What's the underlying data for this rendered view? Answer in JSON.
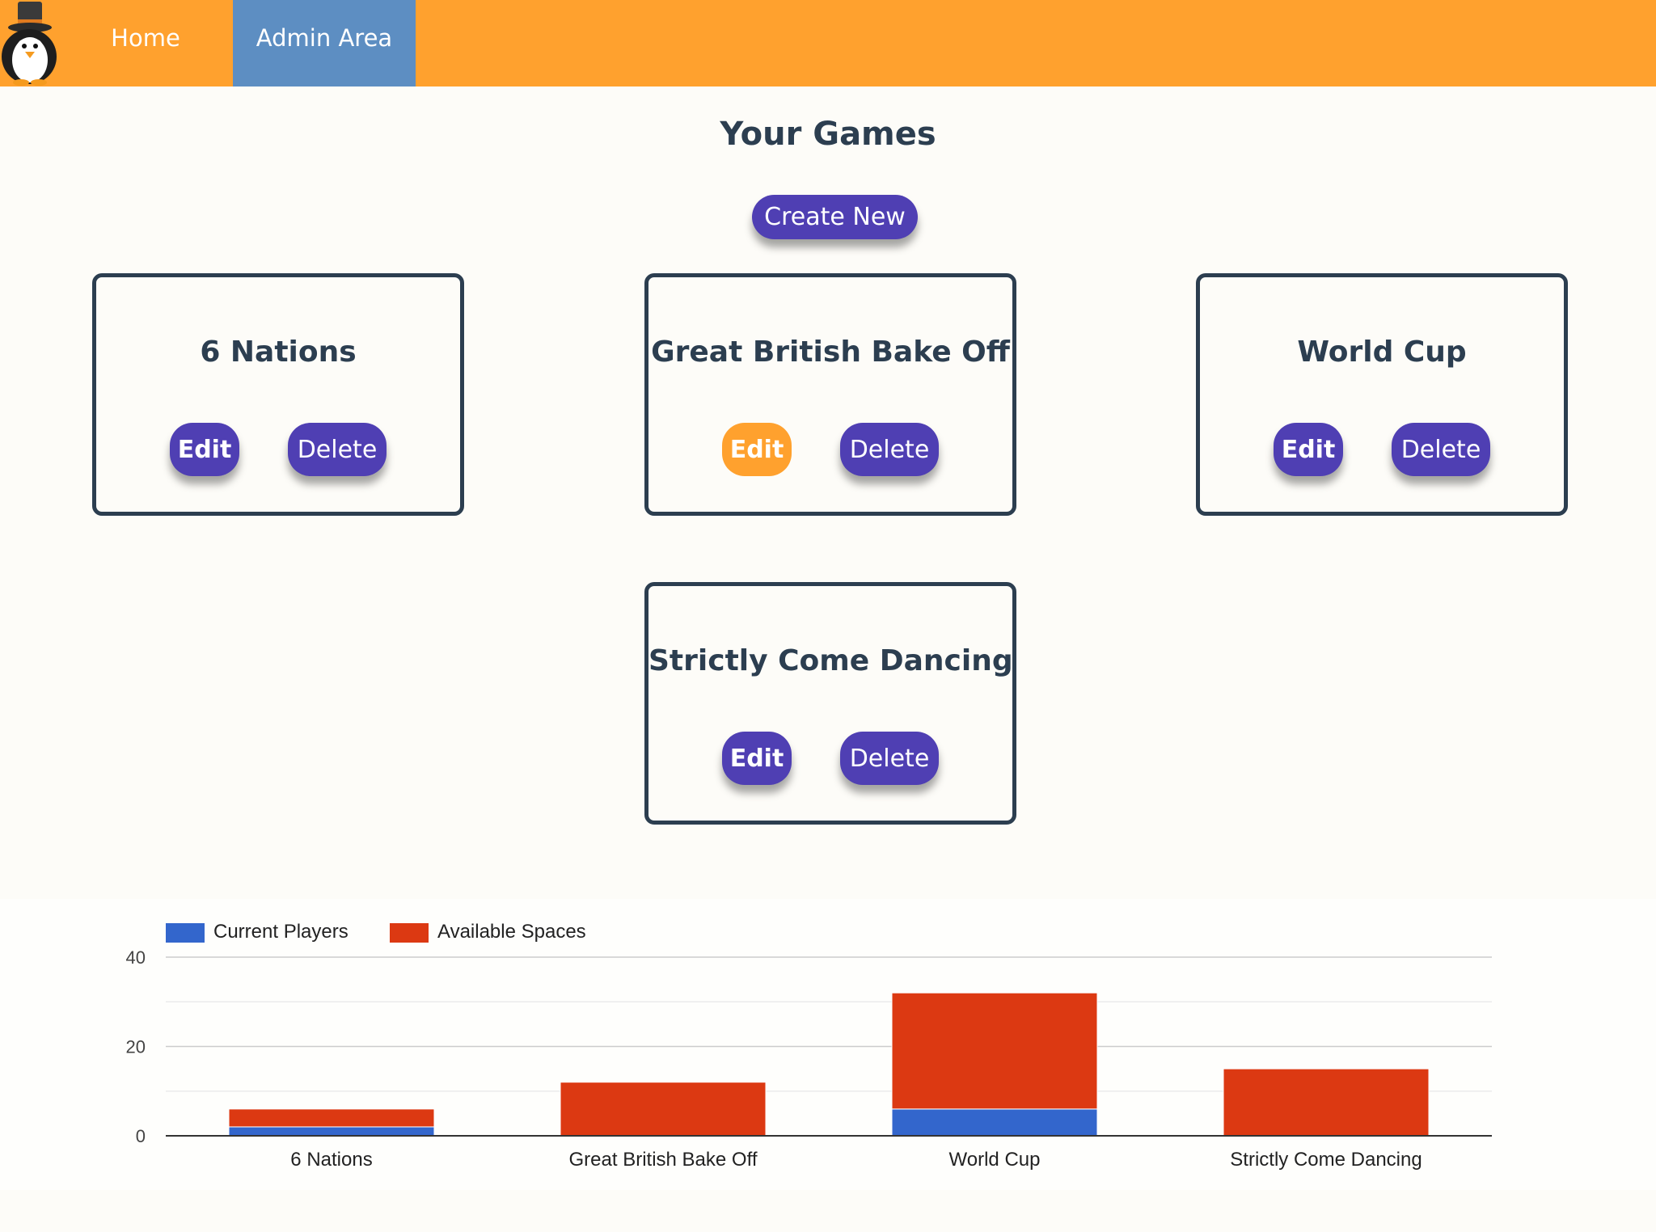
{
  "nav": {
    "logo_icon": "top-hat-penguin-icon",
    "items": [
      {
        "label": "Home"
      },
      {
        "label": "Admin Area",
        "active": true
      }
    ]
  },
  "page": {
    "title": "Your Games",
    "create_label": "Create New"
  },
  "games": [
    {
      "title": "6 Nations",
      "edit_label": "Edit",
      "delete_label": "Delete"
    },
    {
      "title": "Great British Bake Off",
      "edit_label": "Edit",
      "delete_label": "Delete",
      "edit_highlighted": true
    },
    {
      "title": "World Cup",
      "edit_label": "Edit",
      "delete_label": "Delete"
    },
    {
      "title": "Strictly Come Dancing",
      "edit_label": "Edit",
      "delete_label": "Delete"
    }
  ],
  "colors": {
    "nav": "#ffa12e",
    "nav_active": "#5d8ec2",
    "button": "#4f3fb3",
    "button_active": "#ffa12e",
    "series_current": "#3366cc",
    "series_available": "#dc3912"
  },
  "chart_data": {
    "type": "bar",
    "stacked": true,
    "categories": [
      "6 Nations",
      "Great British Bake Off",
      "World Cup",
      "Strictly Come Dancing"
    ],
    "series": [
      {
        "name": "Current Players",
        "values": [
          2,
          0,
          6,
          0
        ]
      },
      {
        "name": "Available Spaces",
        "values": [
          4,
          12,
          26,
          15
        ]
      }
    ],
    "ylim": [
      0,
      40
    ],
    "yticks": [
      0,
      20,
      40
    ],
    "grid": true,
    "legend": "top-left"
  }
}
